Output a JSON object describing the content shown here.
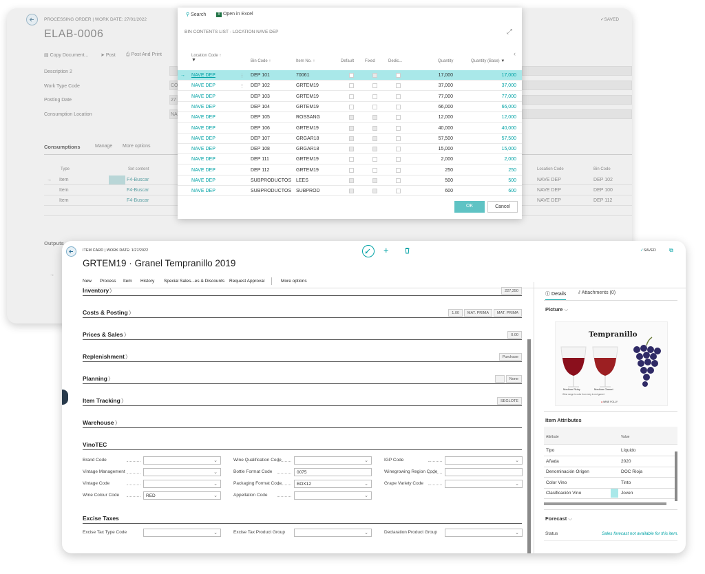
{
  "bg": {
    "subtitle": "PROCESSING ORDER | WORK DATE: 27/01/2022",
    "title": "ELAB-0006",
    "saved": "SAVED",
    "actions": [
      "Copy Document...",
      "Post",
      "Post And Print"
    ],
    "fields": [
      "Description 2",
      "Work Type Code",
      "Posting Date",
      "Consumption Location"
    ],
    "field_values": [
      "",
      "CO",
      "27",
      "NA"
    ],
    "cons_tabs": [
      "Consumptions",
      "Manage",
      "More options"
    ],
    "cons_cols": [
      "Type",
      "Set content",
      "Location Code",
      "Bin Code"
    ],
    "cons_rows": [
      {
        "type": "Item",
        "set": "F4-Buscar",
        "loc": "NAVE DEP",
        "bin": "DEP 102"
      },
      {
        "type": "Item",
        "set": "F4-Buscar",
        "loc": "NAVE DEP",
        "bin": "DEP 100"
      },
      {
        "type": "Item",
        "set": "F4-Buscar",
        "loc": "NAVE DEP",
        "bin": "DEP 112"
      }
    ],
    "outputs": "Outputs"
  },
  "bins": {
    "search": "Search",
    "excel": "Open in Excel",
    "title": "BIN CONTENTS LIST - LOCATION NAVE DEP",
    "cols": [
      "Location Code ↑",
      "Bin Code ↑",
      "Item No. ↑",
      "Default",
      "Fixed",
      "Dedic...",
      "Quantity",
      "Quantity (Base)"
    ],
    "rows": [
      {
        "loc": "NAVE DEP",
        "bin": "DEP 101",
        "item": "70061",
        "d": false,
        "f": true,
        "x": false,
        "q": "17,000",
        "qb": "17,000"
      },
      {
        "loc": "NAVE DEP",
        "bin": "DEP 102",
        "item": "GRTEM19",
        "d": false,
        "f": false,
        "x": false,
        "q": "37,000",
        "qb": "37,000"
      },
      {
        "loc": "NAVE DEP",
        "bin": "DEP 103",
        "item": "GRTEM19",
        "d": false,
        "f": false,
        "x": false,
        "q": "77,000",
        "qb": "77,000"
      },
      {
        "loc": "NAVE DEP",
        "bin": "DEP 104",
        "item": "GRTEM19",
        "d": false,
        "f": false,
        "x": false,
        "q": "66,000",
        "qb": "66,000"
      },
      {
        "loc": "NAVE DEP",
        "bin": "DEP 105",
        "item": "ROSSANG",
        "d": true,
        "f": true,
        "x": false,
        "q": "12,000",
        "qb": "12,000"
      },
      {
        "loc": "NAVE DEP",
        "bin": "DEP 106",
        "item": "GRTEM19",
        "d": true,
        "f": true,
        "x": false,
        "q": "40,000",
        "qb": "40,000"
      },
      {
        "loc": "NAVE DEP",
        "bin": "DEP 107",
        "item": "GRGAR18",
        "d": true,
        "f": true,
        "x": false,
        "q": "57,500",
        "qb": "57,500"
      },
      {
        "loc": "NAVE DEP",
        "bin": "DEP 108",
        "item": "GRGAR18",
        "d": true,
        "f": true,
        "x": false,
        "q": "15,000",
        "qb": "15,000"
      },
      {
        "loc": "NAVE DEP",
        "bin": "DEP 111",
        "item": "GRTEM19",
        "d": false,
        "f": false,
        "x": false,
        "q": "2,000",
        "qb": "2,000"
      },
      {
        "loc": "NAVE DEP",
        "bin": "DEP 112",
        "item": "GRTEM19",
        "d": false,
        "f": false,
        "x": false,
        "q": "250",
        "qb": "250"
      },
      {
        "loc": "NAVE DEP",
        "bin": "SUBPRODUCTOS",
        "item": "LEES",
        "d": true,
        "f": true,
        "x": false,
        "q": "500",
        "qb": "500"
      },
      {
        "loc": "NAVE DEP",
        "bin": "SUBPRODUCTOS",
        "item": "SUBPROD",
        "d": true,
        "f": true,
        "x": false,
        "q": "600",
        "qb": "600"
      }
    ],
    "ok": "OK",
    "cancel": "Cancel"
  },
  "card": {
    "subtitle": "ITEM CARD | WORK DATE: 1/27/2022",
    "title": "GRTEM19 · Granel Tempranillo 2019",
    "saved": "SAVED",
    "menu": [
      "New",
      "Process",
      "Item",
      "History",
      "Special Sales...es & Discounts",
      "Request Approval",
      "More options"
    ],
    "sections": [
      {
        "name": "Inventory",
        "tags": [
          "227,250"
        ]
      },
      {
        "name": "Costs & Posting",
        "tags": [
          "1.00",
          "MAT. PRIMA",
          "MAT. PRIMA"
        ]
      },
      {
        "name": "Prices & Sales",
        "tags": [
          "0.00"
        ]
      },
      {
        "name": "Replenishment",
        "tags": [
          "Purchase"
        ]
      },
      {
        "name": "Planning",
        "tags": [
          "",
          "None"
        ]
      },
      {
        "name": "Item Tracking",
        "tags": [
          "SEGLOTE"
        ]
      },
      {
        "name": "Warehouse",
        "tags": []
      }
    ],
    "vinotec": "VinoTEC",
    "vfields": [
      [
        {
          "l": "Brand Code",
          "v": "",
          "dd": true
        },
        {
          "l": "Wine Qualification Code",
          "v": "",
          "dd": true
        },
        {
          "l": "IGP Code",
          "v": "",
          "dd": true
        }
      ],
      [
        {
          "l": "Vintage Management",
          "v": "",
          "dd": true
        },
        {
          "l": "Bottle Format Code",
          "v": "0075",
          "dd": false
        },
        {
          "l": "Winegrowing Region Code",
          "v": "",
          "dd": false
        }
      ],
      [
        {
          "l": "Vintage Code",
          "v": "",
          "dd": true
        },
        {
          "l": "Packaging Format Code",
          "v": "BOX12",
          "dd": true
        },
        {
          "l": "Grape Variety Code",
          "v": "",
          "dd": true
        }
      ],
      [
        {
          "l": "Wine Colour Code",
          "v": "RED",
          "dd": true
        },
        {
          "l": "Appellation Code",
          "v": "",
          "dd": true
        }
      ]
    ],
    "excise": "Excise Taxes",
    "efields": [
      {
        "l": "Excise Tax Type Code",
        "v": ""
      },
      {
        "l": "Excise Tax Product Group",
        "v": ""
      },
      {
        "l": "Declaration Product Group",
        "v": ""
      }
    ],
    "side": {
      "tab_details": "Details",
      "tab_attach": "Attachments (0)",
      "picture": "Picture",
      "pic_title": "Tempranillo",
      "pic_l1": "Medium Ruby",
      "pic_l2": "Medium Garnet",
      "pic_cap": "Wine range in color from ruby to red garnet",
      "pic_brand": "WINE FOLLY",
      "attr_title": "Item Attributes",
      "attr_cols": [
        "Attribute",
        "Value"
      ],
      "attrs": [
        {
          "a": "Tipo",
          "v": "Líquido"
        },
        {
          "a": "Añada",
          "v": "2020"
        },
        {
          "a": "Denominación Origen",
          "v": "DOC Rioja"
        },
        {
          "a": "Color Vino",
          "v": "Tinto"
        },
        {
          "a": "Clasificación Vino",
          "v": "Joven"
        }
      ],
      "forecast": "Forecast",
      "status_l": "Status",
      "status_v": "Sales forecast not available for this item."
    }
  },
  "colors": {
    "accent": "#00a2a5",
    "highlight": "#a9e8e9",
    "button": "#5fc3c4"
  }
}
